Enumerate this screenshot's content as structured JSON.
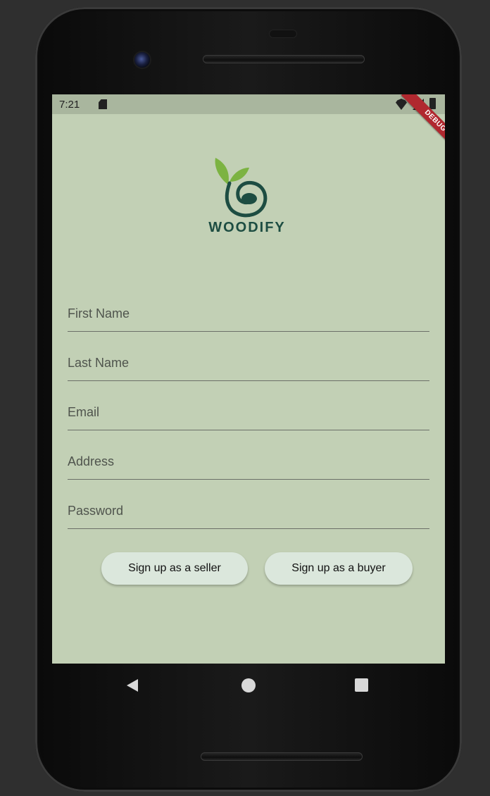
{
  "status_bar": {
    "time": "7:21",
    "debug_label": "DEBUG"
  },
  "brand": {
    "name": "WOODIFY",
    "color": "#1d4d42",
    "leaf_color": "#7cb342"
  },
  "form": {
    "first_name_placeholder": "First Name",
    "last_name_placeholder": "Last Name",
    "email_placeholder": "Email",
    "address_placeholder": "Address",
    "password_placeholder": "Password"
  },
  "actions": {
    "seller_label": "Sign up as a seller",
    "buyer_label": "Sign up as a buyer"
  },
  "theme": {
    "background": "#c2d0b5",
    "button_background": "#dbe7dc"
  },
  "icons": {
    "sd_card": "sd-card-icon",
    "wifi": "wifi-icon",
    "signal": "signal-icon",
    "battery": "battery-icon",
    "back": "back-triangle-icon",
    "home": "home-circle-icon",
    "recents": "recents-square-icon"
  }
}
